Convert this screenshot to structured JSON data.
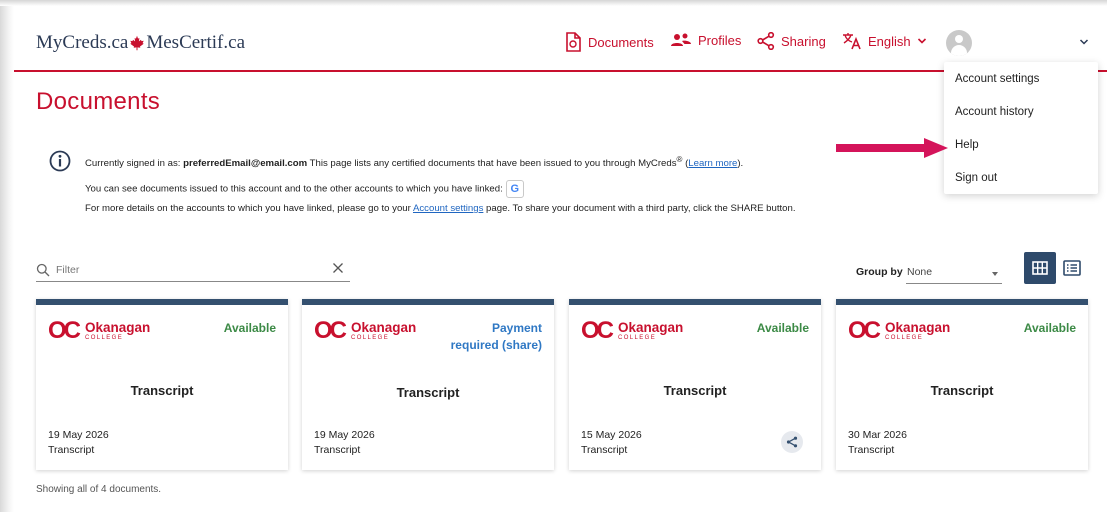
{
  "header": {
    "logo_part1": "MyCreds.ca",
    "logo_part2": "MesCertif.ca",
    "nav": {
      "documents": "Documents",
      "profiles": "Profiles",
      "sharing": "Sharing",
      "language": "English"
    }
  },
  "account_menu": {
    "items": [
      "Account settings",
      "Account history",
      "Help",
      "Sign out"
    ]
  },
  "page": {
    "title": "Documents"
  },
  "info": {
    "line1_prefix": "Currently signed in as: ",
    "email": "preferredEmail@email.com",
    "line1_middle": "  This page lists any certified documents that have been issued to you through MyCreds",
    "line1_reg": "®",
    "line1_link": "Learn more",
    "line2": "You can see documents issued to this account and to the other accounts to which you have linked:",
    "line3_prefix": "For more details on the accounts to which you have linked, please go to your ",
    "line3_link": "Account settings",
    "line3_suffix": " page. To share your document with a third party, click the SHARE button."
  },
  "filter": {
    "placeholder": "Filter",
    "value": ""
  },
  "group_by": {
    "label": "Group by",
    "value": "None"
  },
  "cards": [
    {
      "issuer": "Okanagan",
      "issuer_sub": "COLLEGE",
      "status": "Available",
      "title": "Transcript",
      "date": "19 May 2026",
      "type": "Transcript"
    },
    {
      "issuer": "Okanagan",
      "issuer_sub": "COLLEGE",
      "status_line1": "Payment",
      "status_line2": "required (share)",
      "title": "Transcript",
      "date": "19 May 2026",
      "type": "Transcript"
    },
    {
      "issuer": "Okanagan",
      "issuer_sub": "COLLEGE",
      "status": "Available",
      "title": "Transcript",
      "date": "15 May 2026",
      "type": "Transcript"
    },
    {
      "issuer": "Okanagan",
      "issuer_sub": "COLLEGE",
      "status": "Available",
      "title": "Transcript",
      "date": "30 Mar 2026",
      "type": "Transcript"
    }
  ],
  "footer": {
    "showing": "Showing all of 4 documents."
  },
  "colors": {
    "brand_red": "#c8102e",
    "card_top": "#34506f",
    "available": "#3c8a46",
    "payment": "#2f78c4",
    "link": "#1f66c1"
  }
}
